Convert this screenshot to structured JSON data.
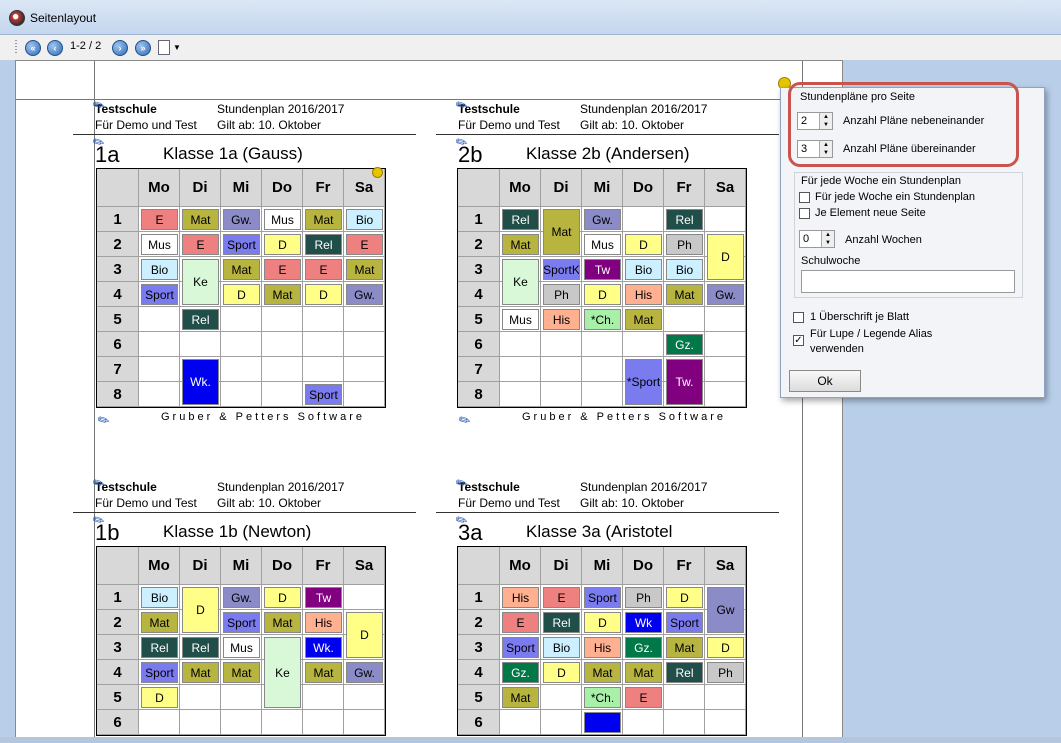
{
  "window": {
    "title": "Seitenlayout"
  },
  "toolbar": {
    "page_counter": "1-2 / 2"
  },
  "colors": {
    "E": "#ee8080",
    "Mat": "#b8b440",
    "Gw": "#8b8bc8",
    "Mus": "#ffffff",
    "Bio": "#ccf0ff",
    "D": "#ffff88",
    "Ke": "#d8f8d8",
    "Sport": "#7b7bf0",
    "Rel": "#1f4f48",
    "Wk": "#0000f0",
    "Ph": "#c8c8c8",
    "Tw": "#800080",
    "His": "#ffb090",
    "Ch": "#a8f0a8",
    "Gz": "#007848"
  },
  "timetables": [
    {
      "school": "Testschule",
      "plan": "Stundenplan 2016/2017",
      "demo": "Für Demo und Test",
      "valid": "Gilt ab: 10. Oktober",
      "code": "1a",
      "title": "Klasse 1a (Gauss)",
      "days": [
        "Mo",
        "Di",
        "Mi",
        "Do",
        "Fr",
        "Sa"
      ],
      "periods": [
        "1",
        "2",
        "3",
        "4",
        "5",
        "6",
        "7",
        "8"
      ],
      "footer": "Gruber & Petters Software",
      "lessons": [
        {
          "d": 0,
          "p": 0,
          "s": 1,
          "t": "E",
          "c": "E"
        },
        {
          "d": 1,
          "p": 0,
          "s": 1,
          "t": "Mat",
          "c": "Mat"
        },
        {
          "d": 2,
          "p": 0,
          "s": 1,
          "t": "Gw.",
          "c": "Gw"
        },
        {
          "d": 3,
          "p": 0,
          "s": 1,
          "t": "Mus",
          "c": "Mus"
        },
        {
          "d": 4,
          "p": 0,
          "s": 1,
          "t": "Mat",
          "c": "Mat"
        },
        {
          "d": 5,
          "p": 0,
          "s": 1,
          "t": "Bio",
          "c": "Bio"
        },
        {
          "d": 0,
          "p": 1,
          "s": 1,
          "t": "Mus",
          "c": "Mus"
        },
        {
          "d": 1,
          "p": 1,
          "s": 1,
          "t": "E",
          "c": "E"
        },
        {
          "d": 2,
          "p": 1,
          "s": 1,
          "t": "Sport",
          "c": "Sport"
        },
        {
          "d": 3,
          "p": 1,
          "s": 1,
          "t": "D",
          "c": "D"
        },
        {
          "d": 4,
          "p": 1,
          "s": 1,
          "t": "Rel",
          "c": "Rel"
        },
        {
          "d": 5,
          "p": 1,
          "s": 1,
          "t": "E",
          "c": "E"
        },
        {
          "d": 0,
          "p": 2,
          "s": 1,
          "t": "Bio",
          "c": "Bio"
        },
        {
          "d": 1,
          "p": 2,
          "s": 2,
          "t": "Ke",
          "c": "Ke"
        },
        {
          "d": 2,
          "p": 2,
          "s": 1,
          "t": "Mat",
          "c": "Mat"
        },
        {
          "d": 3,
          "p": 2,
          "s": 1,
          "t": "E",
          "c": "E"
        },
        {
          "d": 4,
          "p": 2,
          "s": 1,
          "t": "E",
          "c": "E"
        },
        {
          "d": 5,
          "p": 2,
          "s": 1,
          "t": "Mat",
          "c": "Mat"
        },
        {
          "d": 0,
          "p": 3,
          "s": 1,
          "t": "Sport",
          "c": "Sport"
        },
        {
          "d": 2,
          "p": 3,
          "s": 1,
          "t": "D",
          "c": "D"
        },
        {
          "d": 3,
          "p": 3,
          "s": 1,
          "t": "Mat",
          "c": "Mat"
        },
        {
          "d": 4,
          "p": 3,
          "s": 1,
          "t": "D",
          "c": "D"
        },
        {
          "d": 5,
          "p": 3,
          "s": 1,
          "t": "Gw.",
          "c": "Gw"
        },
        {
          "d": 1,
          "p": 4,
          "s": 1,
          "t": "Rel",
          "c": "Rel"
        },
        {
          "d": 1,
          "p": 6,
          "s": 2,
          "t": "Wk.",
          "c": "Wk"
        },
        {
          "d": 4,
          "p": 7,
          "s": 1,
          "t": "Sport",
          "c": "Sport"
        }
      ]
    },
    {
      "school": "Testschule",
      "plan": "Stundenplan 2016/2017",
      "demo": "Für Demo und Test",
      "valid": "Gilt ab: 10. Oktober",
      "code": "2b",
      "title": "Klasse 2b (Andersen)",
      "days": [
        "Mo",
        "Di",
        "Mi",
        "Do",
        "Fr",
        "Sa"
      ],
      "periods": [
        "1",
        "2",
        "3",
        "4",
        "5",
        "6",
        "7",
        "8"
      ],
      "footer": "Gruber & Petters Software",
      "lessons": [
        {
          "d": 0,
          "p": 0,
          "s": 1,
          "t": "Rel",
          "c": "Rel"
        },
        {
          "d": 1,
          "p": 0,
          "s": 2,
          "t": "Mat",
          "c": "Mat"
        },
        {
          "d": 2,
          "p": 0,
          "s": 1,
          "t": "Gw.",
          "c": "Gw"
        },
        {
          "d": 4,
          "p": 0,
          "s": 1,
          "t": "Rel",
          "c": "Rel"
        },
        {
          "d": 0,
          "p": 1,
          "s": 1,
          "t": "Mat",
          "c": "Mat"
        },
        {
          "d": 2,
          "p": 1,
          "s": 1,
          "t": "Mus",
          "c": "Mus"
        },
        {
          "d": 3,
          "p": 1,
          "s": 1,
          "t": "D",
          "c": "D"
        },
        {
          "d": 4,
          "p": 1,
          "s": 1,
          "t": "Ph",
          "c": "Ph"
        },
        {
          "d": 5,
          "p": 1,
          "s": 2,
          "t": "D",
          "c": "D"
        },
        {
          "d": 0,
          "p": 2,
          "s": 2,
          "t": "Ke",
          "c": "Ke"
        },
        {
          "d": 1,
          "p": 2,
          "s": 1,
          "t": "SportK",
          "c": "Sport"
        },
        {
          "d": 2,
          "p": 2,
          "s": 1,
          "t": "Tw",
          "c": "Tw"
        },
        {
          "d": 3,
          "p": 2,
          "s": 1,
          "t": "Bio",
          "c": "Bio"
        },
        {
          "d": 4,
          "p": 2,
          "s": 1,
          "t": "Bio",
          "c": "Bio"
        },
        {
          "d": 1,
          "p": 3,
          "s": 1,
          "t": "Ph",
          "c": "Ph"
        },
        {
          "d": 2,
          "p": 3,
          "s": 1,
          "t": "D",
          "c": "D"
        },
        {
          "d": 3,
          "p": 3,
          "s": 1,
          "t": "His",
          "c": "His"
        },
        {
          "d": 4,
          "p": 3,
          "s": 1,
          "t": "Mat",
          "c": "Mat"
        },
        {
          "d": 5,
          "p": 3,
          "s": 1,
          "t": "Gw.",
          "c": "Gw"
        },
        {
          "d": 0,
          "p": 4,
          "s": 1,
          "t": "Mus",
          "c": "Mus"
        },
        {
          "d": 1,
          "p": 4,
          "s": 1,
          "t": "His",
          "c": "His"
        },
        {
          "d": 2,
          "p": 4,
          "s": 1,
          "t": "*Ch.",
          "c": "Ch"
        },
        {
          "d": 3,
          "p": 4,
          "s": 1,
          "t": "Mat",
          "c": "Mat"
        },
        {
          "d": 4,
          "p": 5,
          "s": 1,
          "t": "Gz.",
          "c": "Gz"
        },
        {
          "d": 3,
          "p": 6,
          "s": 2,
          "t": "*Sport",
          "c": "Sport"
        },
        {
          "d": 4,
          "p": 6,
          "s": 2,
          "t": "Tw.",
          "c": "Tw"
        }
      ]
    },
    {
      "school": "Testschule",
      "plan": "Stundenplan 2016/2017",
      "demo": "Für Demo und Test",
      "valid": "Gilt ab: 10. Oktober",
      "code": "1b",
      "title": "Klasse 1b (Newton)",
      "days": [
        "Mo",
        "Di",
        "Mi",
        "Do",
        "Fr",
        "Sa"
      ],
      "periods": [
        "1",
        "2",
        "3",
        "4",
        "5",
        "6"
      ],
      "footer": "",
      "lessons": [
        {
          "d": 0,
          "p": 0,
          "s": 1,
          "t": "Bio",
          "c": "Bio"
        },
        {
          "d": 1,
          "p": 0,
          "s": 2,
          "t": "D",
          "c": "D"
        },
        {
          "d": 2,
          "p": 0,
          "s": 1,
          "t": "Gw.",
          "c": "Gw"
        },
        {
          "d": 3,
          "p": 0,
          "s": 1,
          "t": "D",
          "c": "D"
        },
        {
          "d": 4,
          "p": 0,
          "s": 1,
          "t": "Tw",
          "c": "Tw"
        },
        {
          "d": 0,
          "p": 1,
          "s": 1,
          "t": "Mat",
          "c": "Mat"
        },
        {
          "d": 2,
          "p": 1,
          "s": 1,
          "t": "Sport",
          "c": "Sport"
        },
        {
          "d": 3,
          "p": 1,
          "s": 1,
          "t": "Mat",
          "c": "Mat"
        },
        {
          "d": 4,
          "p": 1,
          "s": 1,
          "t": "His",
          "c": "His"
        },
        {
          "d": 5,
          "p": 1,
          "s": 2,
          "t": "D",
          "c": "D"
        },
        {
          "d": 0,
          "p": 2,
          "s": 1,
          "t": "Rel",
          "c": "Rel"
        },
        {
          "d": 1,
          "p": 2,
          "s": 1,
          "t": "Rel",
          "c": "Rel"
        },
        {
          "d": 2,
          "p": 2,
          "s": 1,
          "t": "Mus",
          "c": "Mus"
        },
        {
          "d": 3,
          "p": 2,
          "s": 3,
          "t": "Ke",
          "c": "Ke"
        },
        {
          "d": 4,
          "p": 2,
          "s": 1,
          "t": "Wk.",
          "c": "Wk"
        },
        {
          "d": 0,
          "p": 3,
          "s": 1,
          "t": "Sport",
          "c": "Sport"
        },
        {
          "d": 1,
          "p": 3,
          "s": 1,
          "t": "Mat",
          "c": "Mat"
        },
        {
          "d": 2,
          "p": 3,
          "s": 1,
          "t": "Mat",
          "c": "Mat"
        },
        {
          "d": 4,
          "p": 3,
          "s": 1,
          "t": "Mat",
          "c": "Mat"
        },
        {
          "d": 5,
          "p": 3,
          "s": 1,
          "t": "Gw.",
          "c": "Gw"
        },
        {
          "d": 0,
          "p": 4,
          "s": 1,
          "t": "D",
          "c": "D"
        }
      ]
    },
    {
      "school": "Testschule",
      "plan": "Stundenplan 2016/2017",
      "demo": "Für Demo und Test",
      "valid": "Gilt ab: 10. Oktober",
      "code": "3a",
      "title": "Klasse 3a (Aristotel",
      "days": [
        "Mo",
        "Di",
        "Mi",
        "Do",
        "Fr",
        "Sa"
      ],
      "periods": [
        "1",
        "2",
        "3",
        "4",
        "5",
        "6"
      ],
      "footer": "",
      "lessons": [
        {
          "d": 0,
          "p": 0,
          "s": 1,
          "t": "His",
          "c": "His"
        },
        {
          "d": 1,
          "p": 0,
          "s": 1,
          "t": "E",
          "c": "E"
        },
        {
          "d": 2,
          "p": 0,
          "s": 1,
          "t": "Sport",
          "c": "Sport"
        },
        {
          "d": 3,
          "p": 0,
          "s": 1,
          "t": "Ph",
          "c": "Ph"
        },
        {
          "d": 4,
          "p": 0,
          "s": 1,
          "t": "D",
          "c": "D"
        },
        {
          "d": 5,
          "p": 0,
          "s": 2,
          "t": "Gw",
          "c": "Gw"
        },
        {
          "d": 0,
          "p": 1,
          "s": 1,
          "t": "E",
          "c": "E"
        },
        {
          "d": 1,
          "p": 1,
          "s": 1,
          "t": "Rel",
          "c": "Rel"
        },
        {
          "d": 2,
          "p": 1,
          "s": 1,
          "t": "D",
          "c": "D"
        },
        {
          "d": 3,
          "p": 1,
          "s": 1,
          "t": "Wk",
          "c": "Wk"
        },
        {
          "d": 4,
          "p": 1,
          "s": 1,
          "t": "Sport",
          "c": "Sport"
        },
        {
          "d": 0,
          "p": 2,
          "s": 1,
          "t": "Sport",
          "c": "Sport"
        },
        {
          "d": 1,
          "p": 2,
          "s": 1,
          "t": "Bio",
          "c": "Bio"
        },
        {
          "d": 2,
          "p": 2,
          "s": 1,
          "t": "His",
          "c": "His"
        },
        {
          "d": 3,
          "p": 2,
          "s": 1,
          "t": "Gz.",
          "c": "Gz"
        },
        {
          "d": 4,
          "p": 2,
          "s": 1,
          "t": "Mat",
          "c": "Mat"
        },
        {
          "d": 5,
          "p": 2,
          "s": 1,
          "t": "D",
          "c": "D"
        },
        {
          "d": 0,
          "p": 3,
          "s": 1,
          "t": "Gz.",
          "c": "Gz"
        },
        {
          "d": 1,
          "p": 3,
          "s": 1,
          "t": "D",
          "c": "D"
        },
        {
          "d": 2,
          "p": 3,
          "s": 1,
          "t": "Mat",
          "c": "Mat"
        },
        {
          "d": 3,
          "p": 3,
          "s": 1,
          "t": "Mat",
          "c": "Mat"
        },
        {
          "d": 4,
          "p": 3,
          "s": 1,
          "t": "Rel",
          "c": "Rel"
        },
        {
          "d": 5,
          "p": 3,
          "s": 1,
          "t": "Ph",
          "c": "Ph"
        },
        {
          "d": 0,
          "p": 4,
          "s": 1,
          "t": "Mat",
          "c": "Mat"
        },
        {
          "d": 2,
          "p": 4,
          "s": 1,
          "t": "*Ch.",
          "c": "Ch"
        },
        {
          "d": 3,
          "p": 4,
          "s": 1,
          "t": "E",
          "c": "E"
        },
        {
          "d": 2,
          "p": 5,
          "s": 1,
          "t": "",
          "c": "Wk"
        }
      ]
    }
  ],
  "dialog": {
    "section_title": "Stundenpläne pro Seite",
    "plans_side_value": "2",
    "plans_side_label": "Anzahl Pläne nebeneinander",
    "plans_stack_value": "3",
    "plans_stack_label": "Anzahl Pläne übereinander",
    "week_group_title": "Für jede Woche ein Stundenplan",
    "week_check_label": "Für jede Woche ein Stundenplan",
    "element_check_label": "Je Element neue Seite",
    "weeks_value": "0",
    "weeks_label": "Anzahl Wochen",
    "school_week_label": "Schulwoche",
    "school_week_value": "",
    "heading_check_label": "1 Überschrift je Blatt",
    "alias_check_label": "Für Lupe / Legende Alias verwenden",
    "alias_checked_mark": "✓",
    "ok_label": "Ok"
  }
}
